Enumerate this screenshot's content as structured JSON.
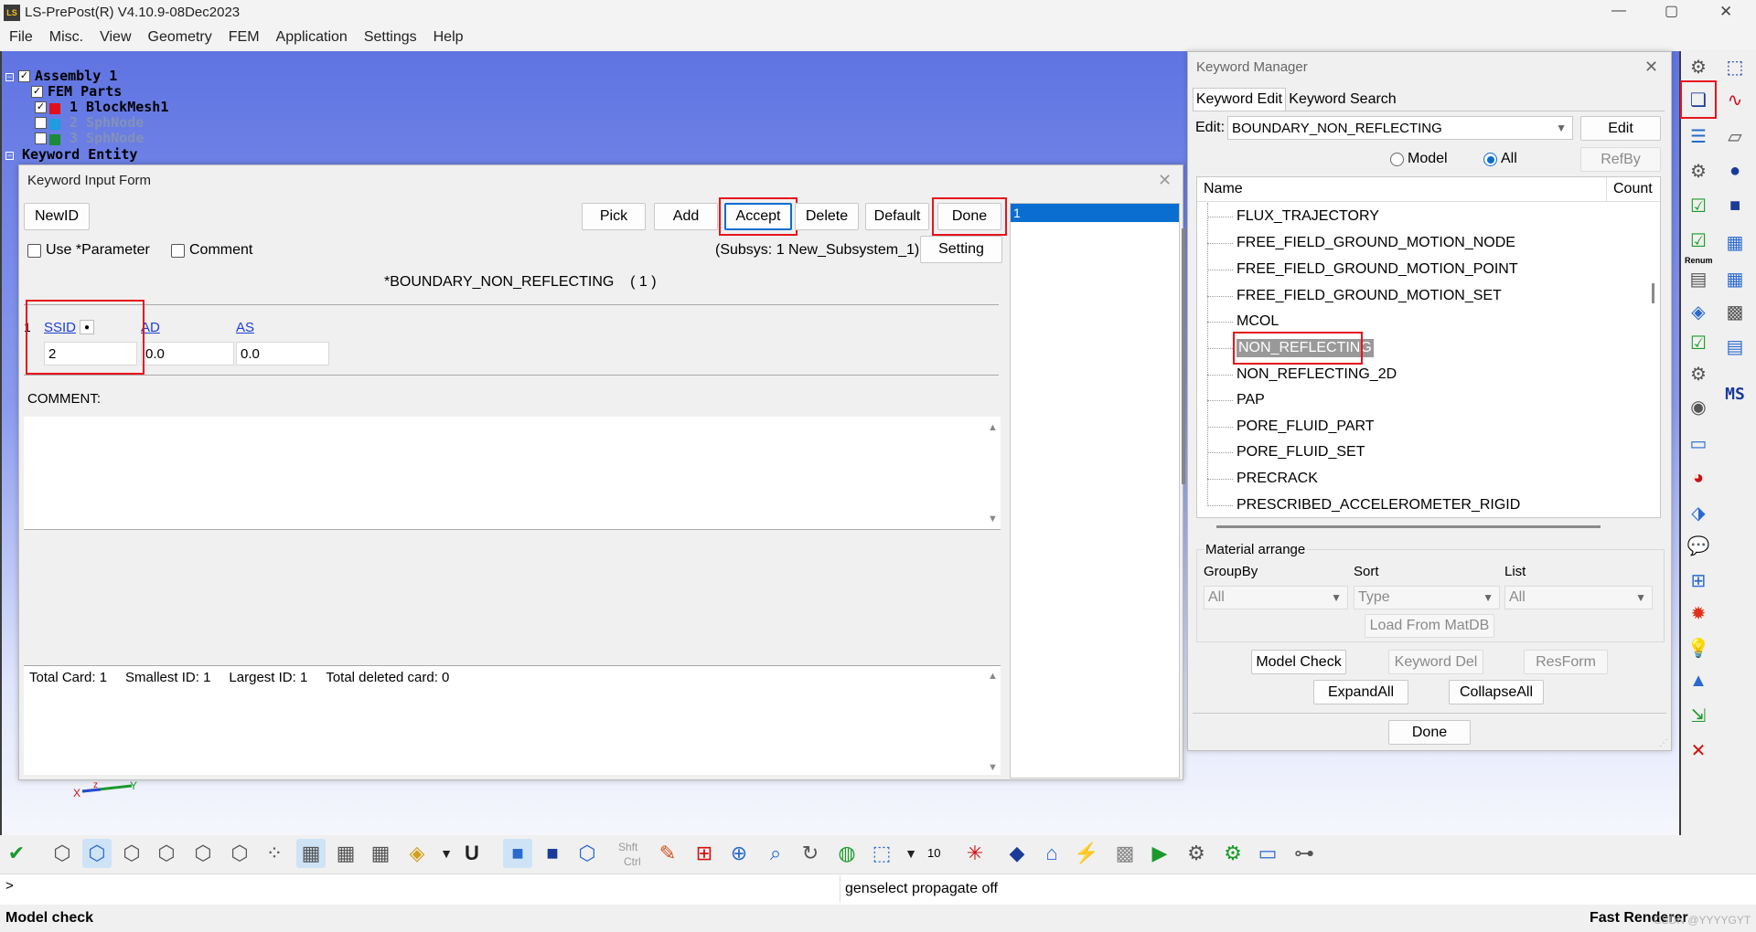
{
  "window": {
    "title": "LS-PrePost(R) V4.10.9-08Dec2023",
    "controls": {
      "minimize": "—",
      "maximize": "▢",
      "close": "✕"
    }
  },
  "menu": [
    "File",
    "Misc.",
    "View",
    "Geometry",
    "FEM",
    "Application",
    "Settings",
    "Help"
  ],
  "tree": {
    "assembly": "Assembly 1",
    "fem_parts": "FEM Parts",
    "parts": [
      {
        "label": "1 BlockMesh1",
        "color": "#e0101c",
        "active": true
      },
      {
        "label": "2 SphNode",
        "color": "#1e9de0",
        "active": false
      },
      {
        "label": "3 SphNode",
        "color": "#1b8a3a",
        "active": false
      }
    ],
    "keyword_entity": "Keyword Entity"
  },
  "kif": {
    "title": "Keyword Input Form",
    "newid": "NewID",
    "pick": "Pick",
    "add": "Add",
    "accept": "Accept",
    "delete": "Delete",
    "default": "Default",
    "done": "Done",
    "use_param": "Use *Parameter",
    "comment_cb": "Comment",
    "subsys": "(Subsys: 1 New_Subsystem_1)",
    "setting": "Setting",
    "keyword": "*BOUNDARY_NON_REFLECTING",
    "keyword_count": "( 1 )",
    "card_num": "1",
    "fields": [
      {
        "label": "SSID",
        "value": "2"
      },
      {
        "label": "AD",
        "value": "0.0"
      },
      {
        "label": "AS",
        "value": "0.0"
      }
    ],
    "comment_label": "COMMENT:",
    "total_card": "Total Card: 1",
    "smallest_id": "Smallest ID: 1",
    "largest_id": "Largest ID: 1",
    "total_deleted": "Total deleted card:  0",
    "id_list": [
      "1"
    ]
  },
  "km": {
    "title": "Keyword Manager",
    "tabs": [
      "Keyword Edit",
      "Keyword Search"
    ],
    "edit_label": "Edit:",
    "edit_value": "BOUNDARY_NON_REFLECTING",
    "edit_btn": "Edit",
    "radio_model": "Model",
    "radio_all": "All",
    "refby": "RefBy",
    "col_name": "Name",
    "col_count": "Count",
    "items": [
      "FLUX_TRAJECTORY",
      "FREE_FIELD_GROUND_MOTION_NODE",
      "FREE_FIELD_GROUND_MOTION_POINT",
      "FREE_FIELD_GROUND_MOTION_SET",
      "MCOL",
      "NON_REFLECTING",
      "NON_REFLECTING_2D",
      "PAP",
      "PORE_FLUID_PART",
      "PORE_FLUID_SET",
      "PRECRACK",
      "PRESCRIBED_ACCELEROMETER_RIGID"
    ],
    "material_arrange": "Material arrange",
    "groupby_label": "GroupBy",
    "sort_label": "Sort",
    "list_label": "List",
    "groupby_value": "All",
    "sort_value": "Type",
    "list_value": "All",
    "load_matdb": "Load From MatDB",
    "model_check": "Model Check",
    "keyword_del": "Keyword Del",
    "resform": "ResForm",
    "expand_all": "ExpandAll",
    "collapse_all": "CollapseAll",
    "done": "Done"
  },
  "toolbar_right": {
    "renum": "Renum",
    "ms": "MS"
  },
  "bottom": {
    "shft": "Shft",
    "ctrl": "Ctrl",
    "num10": "10",
    "prompt": ">",
    "cmd_output": "genselect propagate off",
    "status_left": "Model check",
    "status_right": "Fast Renderer",
    "watermark": "CSDN @YYYYGYT"
  },
  "colors": {
    "viewport": "#6a7ee6",
    "accent": "#0a6ed1",
    "highlight_red": "#e8141c"
  }
}
